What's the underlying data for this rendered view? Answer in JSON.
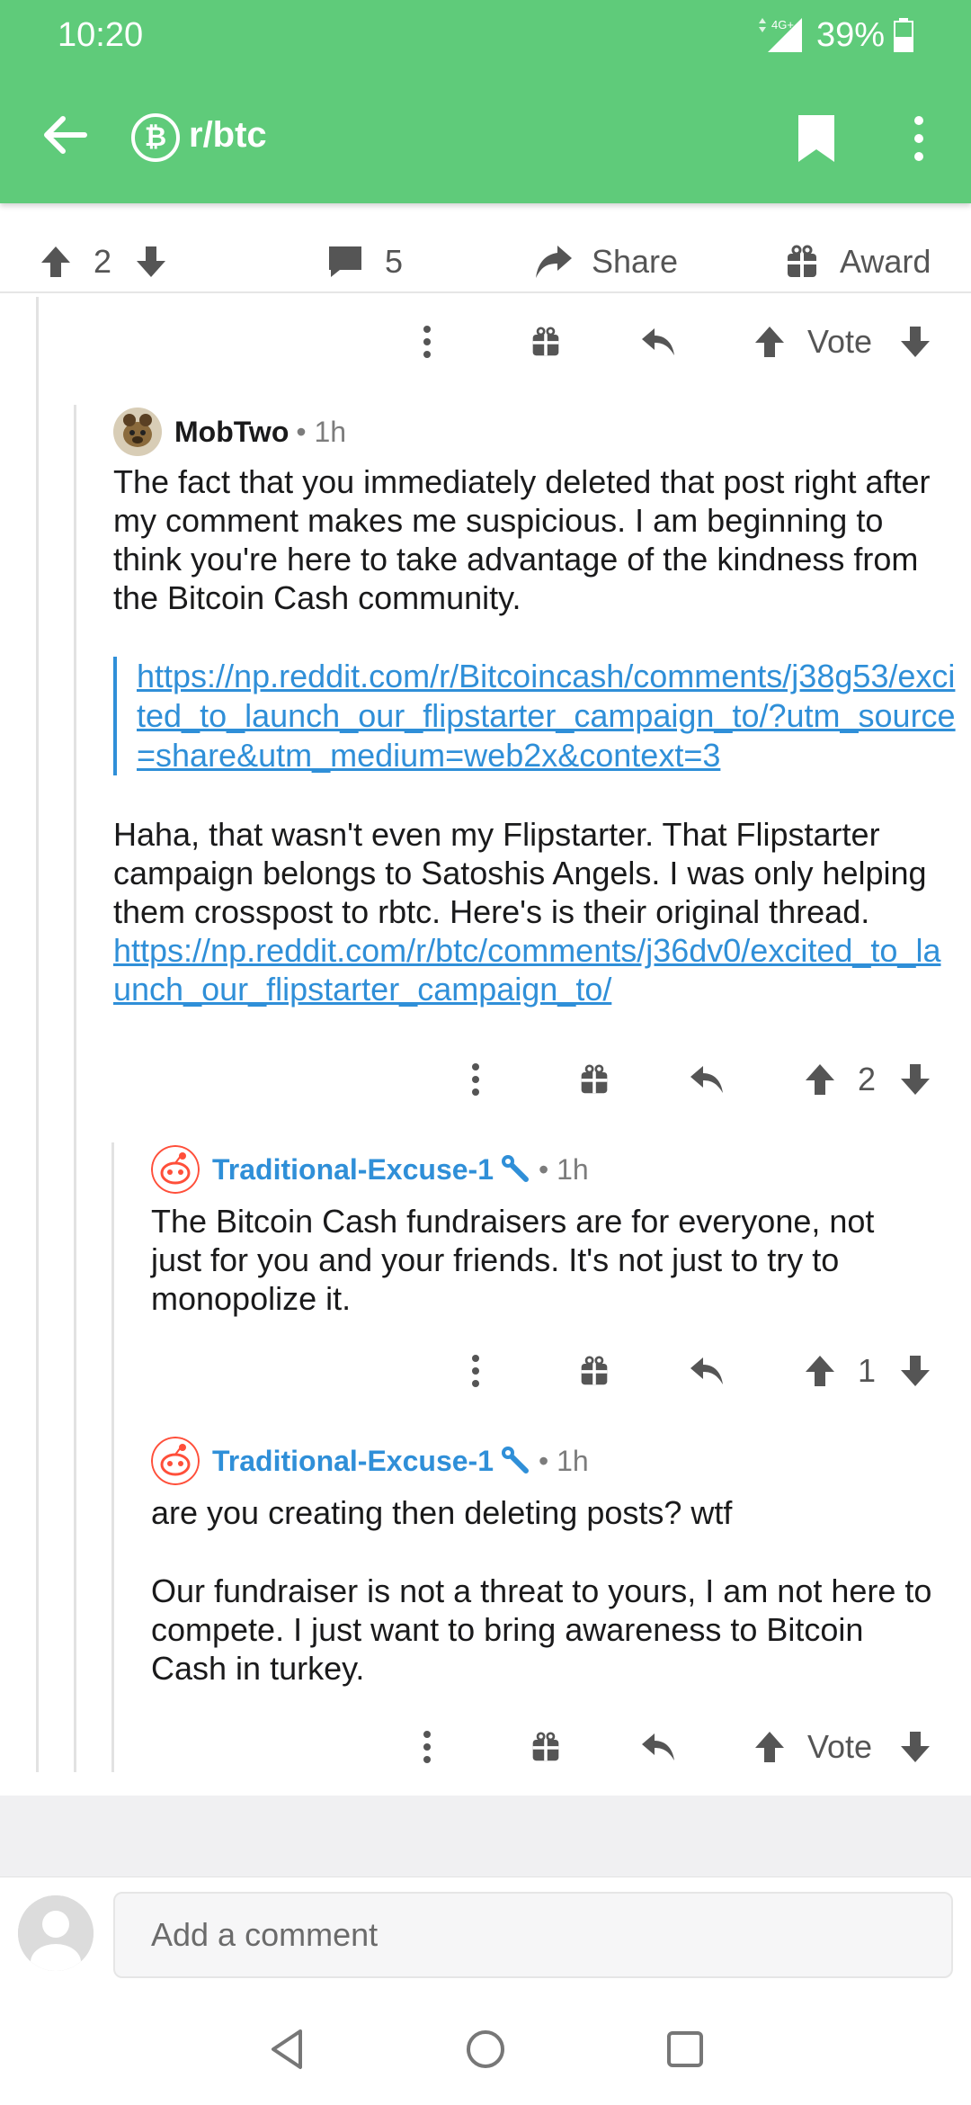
{
  "status": {
    "time": "10:20",
    "battery": "39%",
    "network": "4G+"
  },
  "appbar": {
    "subreddit": "r/btc",
    "sub_icon_letter": "₿"
  },
  "postbar": {
    "votes": "2",
    "comments": "5",
    "share": "Share",
    "award": "Award"
  },
  "top_actions": {
    "vote": "Vote"
  },
  "comments": [
    {
      "author": "MobTwo",
      "time": "1h",
      "paragraph1": "The fact that you immediately deleted that post right after my comment makes me suspicious. I am beginning to think you're here to take advantage of the kindness from the Bitcoin Cash community.",
      "quote_link": "https://np.reddit.com/r/Bitcoincash/comments/j38g53/excited_to_launch_our_flipstarter_campaign_to/?utm_source=share&utm_medium=web2x&context=3",
      "paragraph2": "Haha, that wasn't even my Flipstarter. That Flipstarter campaign belongs to Satoshis Angels. I was only helping them crosspost to rbtc. Here's is their original thread.",
      "link2": "https://np.reddit.com/r/btc/comments/j36dv0/excited_to_launch_our_flipstarter_campaign_to/",
      "score": "2"
    },
    {
      "author": "Traditional-Excuse-1",
      "time": "1h",
      "text": "The Bitcoin Cash fundraisers are for everyone, not just for you and your friends. It's not just to try to monopolize it.",
      "score": "1"
    },
    {
      "author": "Traditional-Excuse-1",
      "time": "1h",
      "paragraph1": "are you creating then deleting posts? wtf",
      "paragraph2": "Our fundraiser is not a threat to yours, I am not here to compete. I just want to bring awareness to Bitcoin Cash in turkey.",
      "score": "Vote"
    }
  ],
  "composer": {
    "placeholder": "Add a comment"
  },
  "colors": {
    "appbar": "#5fcb7a",
    "link": "#2f8fd8"
  }
}
